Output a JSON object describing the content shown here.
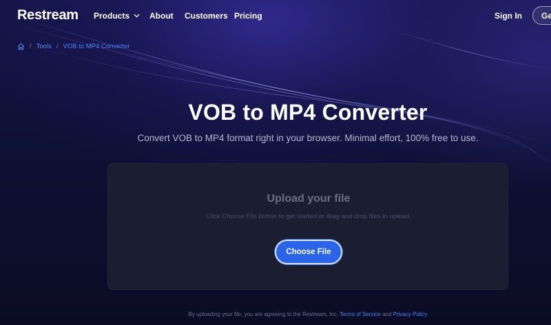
{
  "nav": {
    "logo": "Restream",
    "items": [
      {
        "label": "Products",
        "has_dropdown": true
      },
      {
        "label": "About"
      },
      {
        "label": "Customers"
      },
      {
        "label": "Pricing"
      }
    ],
    "sign_in": "Sign In",
    "get_started": "Get"
  },
  "breadcrumb": {
    "home_icon": "home-icon",
    "items": [
      "Tools",
      "VOB to MP4 Converter"
    ],
    "separator": "/"
  },
  "hero": {
    "title": "VOB to MP4 Converter",
    "subtitle": "Convert VOB to MP4 format right in your browser. Minimal effort, 100% free to use."
  },
  "upload": {
    "title": "Upload your file",
    "hint": "Click Choose File button to get started or drag and drop files to upload.",
    "button_label": "Choose File"
  },
  "footer": {
    "prefix": "By uploading your file, you are agreeing to the Restream, Inc.",
    "terms": "Terms of Service",
    "and": "and",
    "privacy": "Privacy Policy"
  },
  "colors": {
    "accent": "#2a64e8",
    "link": "#4c86ff",
    "background": "#0c0d26",
    "card": "#1b1e30"
  }
}
